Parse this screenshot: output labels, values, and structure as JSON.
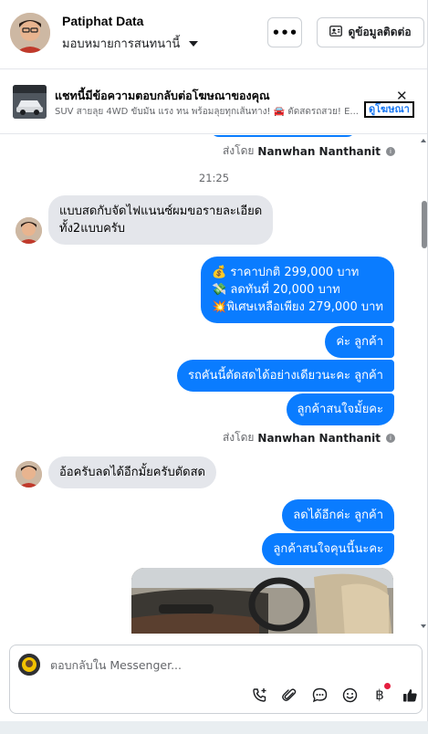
{
  "header": {
    "contact_name": "Patiphat Data",
    "assign_label": "มอบหมายการสนทนานี้",
    "more_label": "•••",
    "contact_info_label": "ดูข้อมูลติดต่อ"
  },
  "ad_banner": {
    "title": "แชทนี้มีข้อความตอบกลับต่อโฆษณาของคุณ",
    "subtitle": "SUV สายลุย 4WD ขับมัน แรง ทน พร้อมลุยทุกเส้นทาง! 🚘 ตัดสดรถสวย! E...",
    "view_ad_label": "ดูโฆษณา",
    "close_label": "✕"
  },
  "conversation": {
    "sent_by_prefix": "ส่งโดย",
    "sent_by_name": "Nanwhan Nanthanit",
    "time": "21:25",
    "incoming_1": "แบบสดกับจัดไฟแนนซ์ผมขอรายละเอียด\nทั้ง2แบบครับ",
    "outgoing_price_1": "💰 ราคาปกติ 299,000 บาท",
    "outgoing_price_2": "💸 ลดทันที่ 20,000 บาท",
    "outgoing_price_3": "💥พิเศษเหลือเพียง 279,000 บาท",
    "outgoing_2": "ค่ะ  ลูกค้า",
    "outgoing_3": "รถคันนี้ตัดสดได้อย่างเดียวนะคะ  ลูกค้า",
    "outgoing_4": "ลูกค้าสนใจมั้ยคะ",
    "incoming_2": "อ้อครับลดได้อีกมั้ยครับตัดสด",
    "outgoing_5": "ลดได้อีกค่ะ  ลูกค้า",
    "outgoing_6": "ลูกค้าสนใจคุนนี้นะคะ"
  },
  "composer": {
    "placeholder": "ตอบกลับใน Messenger..."
  },
  "icons": {
    "more": "more-horizontal-icon",
    "contact": "contact-card-icon",
    "info": "info-icon",
    "call": "add-call-icon",
    "attach": "paperclip-icon",
    "saved_reply": "chat-bubble-icon",
    "emoji": "smiley-icon",
    "payment": "baht-icon",
    "like": "thumbs-up-icon"
  },
  "colors": {
    "accent": "#0a7cff",
    "incoming_bubble": "#e4e6eb",
    "notification_dot": "#e41e3f"
  }
}
